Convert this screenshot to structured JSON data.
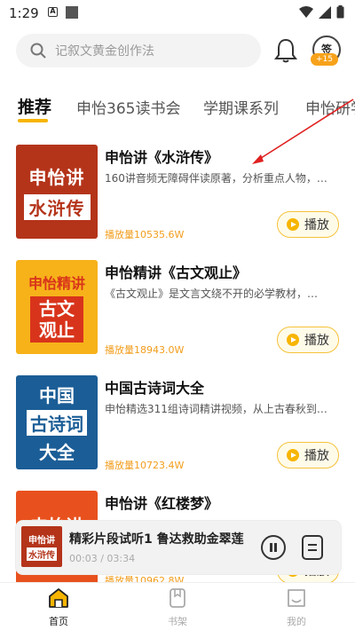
{
  "status_bar": {
    "time": "1:29",
    "a_badge": "A"
  },
  "search": {
    "placeholder": "记叙文黄金创作法"
  },
  "sign_in": {
    "label": "签",
    "badge": "+15"
  },
  "tabs": [
    {
      "label": "推荐",
      "active": true
    },
    {
      "label": "申怡365读书会",
      "active": false
    },
    {
      "label": "学期课系列",
      "active": false
    },
    {
      "label": "申怡研学",
      "active": false
    }
  ],
  "items": [
    {
      "title": "申怡讲《水浒传》",
      "description": "160讲音频无障碍伴读原著，分析重点人物，…",
      "plays": "播放量10535.6W",
      "play_label": "播放",
      "cover": {
        "line1": "申怡讲",
        "line2": "水浒传"
      }
    },
    {
      "title": "申怡精讲《古文观止》",
      "description": "《古文观止》是文言文绕不开的必学教材，…",
      "plays": "播放量18943.0W",
      "play_label": "播放",
      "cover": {
        "line1": "申怡精讲",
        "line2": "古文观止"
      }
    },
    {
      "title": "中国古诗词大全",
      "description": "申怡精选311组诗词精讲视频，从上古春秋到…",
      "plays": "播放量10723.4W",
      "play_label": "播放",
      "cover": {
        "line1": "中国",
        "line2": "古诗词",
        "line3": "大全"
      }
    },
    {
      "title": "申怡讲《红楼梦》",
      "description": "",
      "plays": "播放量10962.8W",
      "play_label": "播放",
      "cover": {
        "line1": "申怡讲"
      }
    }
  ],
  "mini_player": {
    "title": "精彩片段试听1 鲁达救助金翠莲",
    "time": "00:03 / 03:34",
    "cover": {
      "line1": "申怡讲",
      "line2": "水浒传"
    }
  },
  "bottom_nav": [
    {
      "label": "首页",
      "active": true
    },
    {
      "label": "书架",
      "active": false
    },
    {
      "label": "我的",
      "active": false
    }
  ],
  "colors": {
    "accent": "#f7b500",
    "plays": "#f29d1c",
    "annotation": "#e02020"
  }
}
